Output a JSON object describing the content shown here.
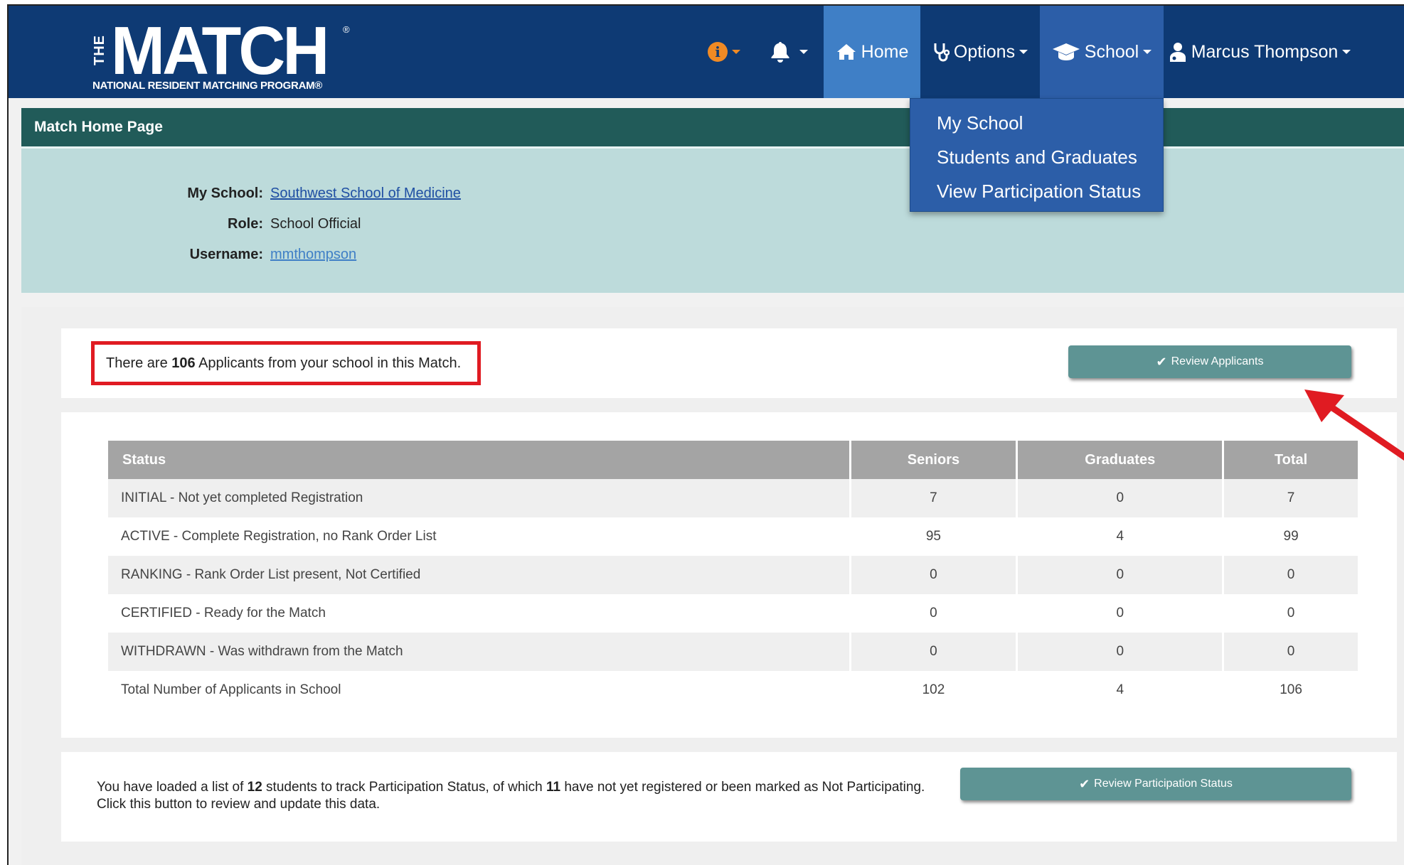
{
  "logo": {
    "the": "THE",
    "match": "MATCH",
    "registered": "®",
    "subtitle": "NATIONAL RESIDENT MATCHING PROGRAM®"
  },
  "nav": {
    "home": "Home",
    "options": "Options",
    "school": "School",
    "user": "Marcus Thompson"
  },
  "school_menu": {
    "items": [
      "My School",
      "Students and Graduates",
      "View Participation Status"
    ]
  },
  "page": {
    "title": "Match Home Page"
  },
  "info": {
    "school_label": "My School:",
    "school_value": "Southwest School of Medicine",
    "role_label": "Role:",
    "role_value": "School Official",
    "username_label": "Username:",
    "username_value": "mmthompson"
  },
  "applicants": {
    "prefix": "There are ",
    "count": "106",
    "suffix": " Applicants from your school in this Match.",
    "button": "Review Applicants"
  },
  "table": {
    "headers": [
      "Status",
      "Seniors",
      "Graduates",
      "Total"
    ],
    "rows": [
      [
        "INITIAL - Not yet completed Registration",
        "7",
        "0",
        "7"
      ],
      [
        "ACTIVE - Complete Registration, no Rank Order List",
        "95",
        "4",
        "99"
      ],
      [
        "RANKING - Rank Order List present, Not Certified",
        "0",
        "0",
        "0"
      ],
      [
        "CERTIFIED - Ready for the Match",
        "0",
        "0",
        "0"
      ],
      [
        "WITHDRAWN - Was withdrawn from the Match",
        "0",
        "0",
        "0"
      ],
      [
        "Total Number of Applicants in School",
        "102",
        "4",
        "106"
      ]
    ]
  },
  "participation": {
    "t1": "You have loaded a list of ",
    "n1": "12",
    "t2": " students to track Participation Status, of which ",
    "n2": "11",
    "t3": " have not yet registered or been marked as Not Participating. Click this button to review and update this data.",
    "button": "Review Participation Status"
  },
  "colors": {
    "navbar": "#0e3a74",
    "nav_active": "#3f7fc6",
    "header_bar": "#215b59",
    "info_panel": "#bddbdb",
    "button": "#5e9494",
    "highlight": "#e01b22"
  }
}
